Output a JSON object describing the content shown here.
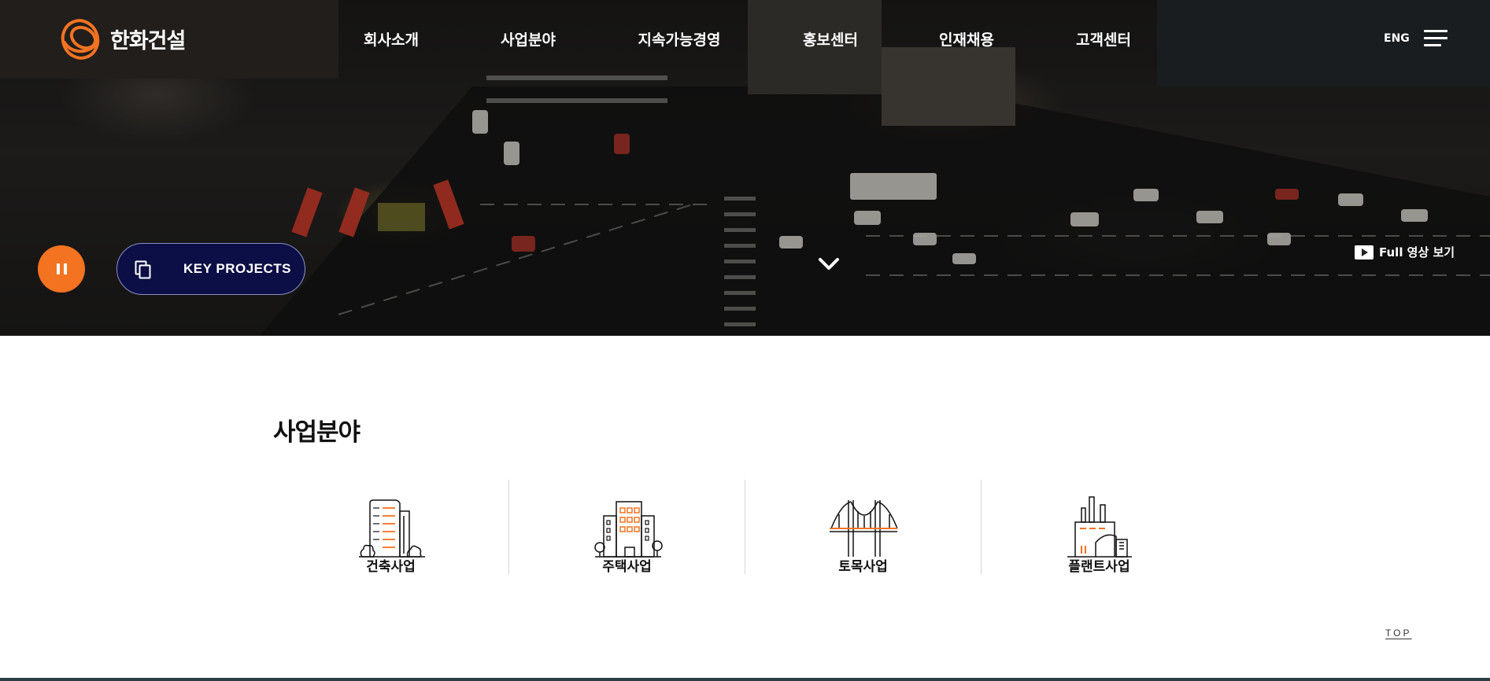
{
  "brand": {
    "name": "한화건설",
    "accent": "#f37321"
  },
  "nav": {
    "items": [
      {
        "label": "회사소개"
      },
      {
        "label": "사업분야"
      },
      {
        "label": "지속가능경영"
      },
      {
        "label": "홍보센터"
      },
      {
        "label": "인재채용"
      },
      {
        "label": "고객센터"
      }
    ],
    "lang": "ENG",
    "menu_icon": "hamburger-icon"
  },
  "hero": {
    "pause_icon": "pause-icon",
    "key_projects_label": "KEY PROJECTS",
    "key_projects_icon": "copy-icon",
    "scroll_icon": "chevron-down-icon",
    "full_video_label": "Full 영상 보기",
    "full_video_icon": "play-icon"
  },
  "business": {
    "title": "사업분야",
    "items": [
      {
        "label": "건축사업",
        "icon": "building-icon"
      },
      {
        "label": "주택사업",
        "icon": "housing-icon"
      },
      {
        "label": "토목사업",
        "icon": "bridge-icon"
      },
      {
        "label": "플랜트사업",
        "icon": "plant-icon"
      }
    ]
  },
  "top_label": "TOP",
  "colors": {
    "hero_bg": "#1e1d1c",
    "key_projects_bg": "#0c0f45",
    "text_dark": "#111111"
  }
}
